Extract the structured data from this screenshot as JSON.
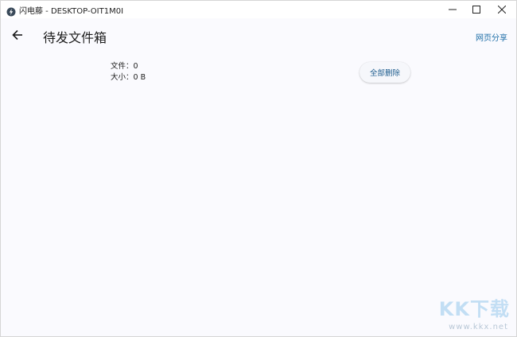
{
  "window": {
    "title": "闪电藤 - DESKTOP-OIT1M0I",
    "icons": {
      "app": "lightning-app-icon",
      "minimize": "minimize-icon",
      "maximize": "maximize-icon",
      "close": "close-icon"
    }
  },
  "appbar": {
    "back_icon": "arrow-left-icon",
    "title": "待发文件箱",
    "share_link": "网页分享"
  },
  "summary": {
    "files_label": "文件：",
    "files_count": "0",
    "size_label": "大小：",
    "size_value": "0 B"
  },
  "actions": {
    "delete_all": "全部删除"
  },
  "watermark": {
    "logo": "KK下载",
    "url": "www.kkx.net"
  },
  "colors": {
    "background": "#fafafe",
    "link": "#1f6fa8",
    "button_text": "#1a5a8c"
  }
}
